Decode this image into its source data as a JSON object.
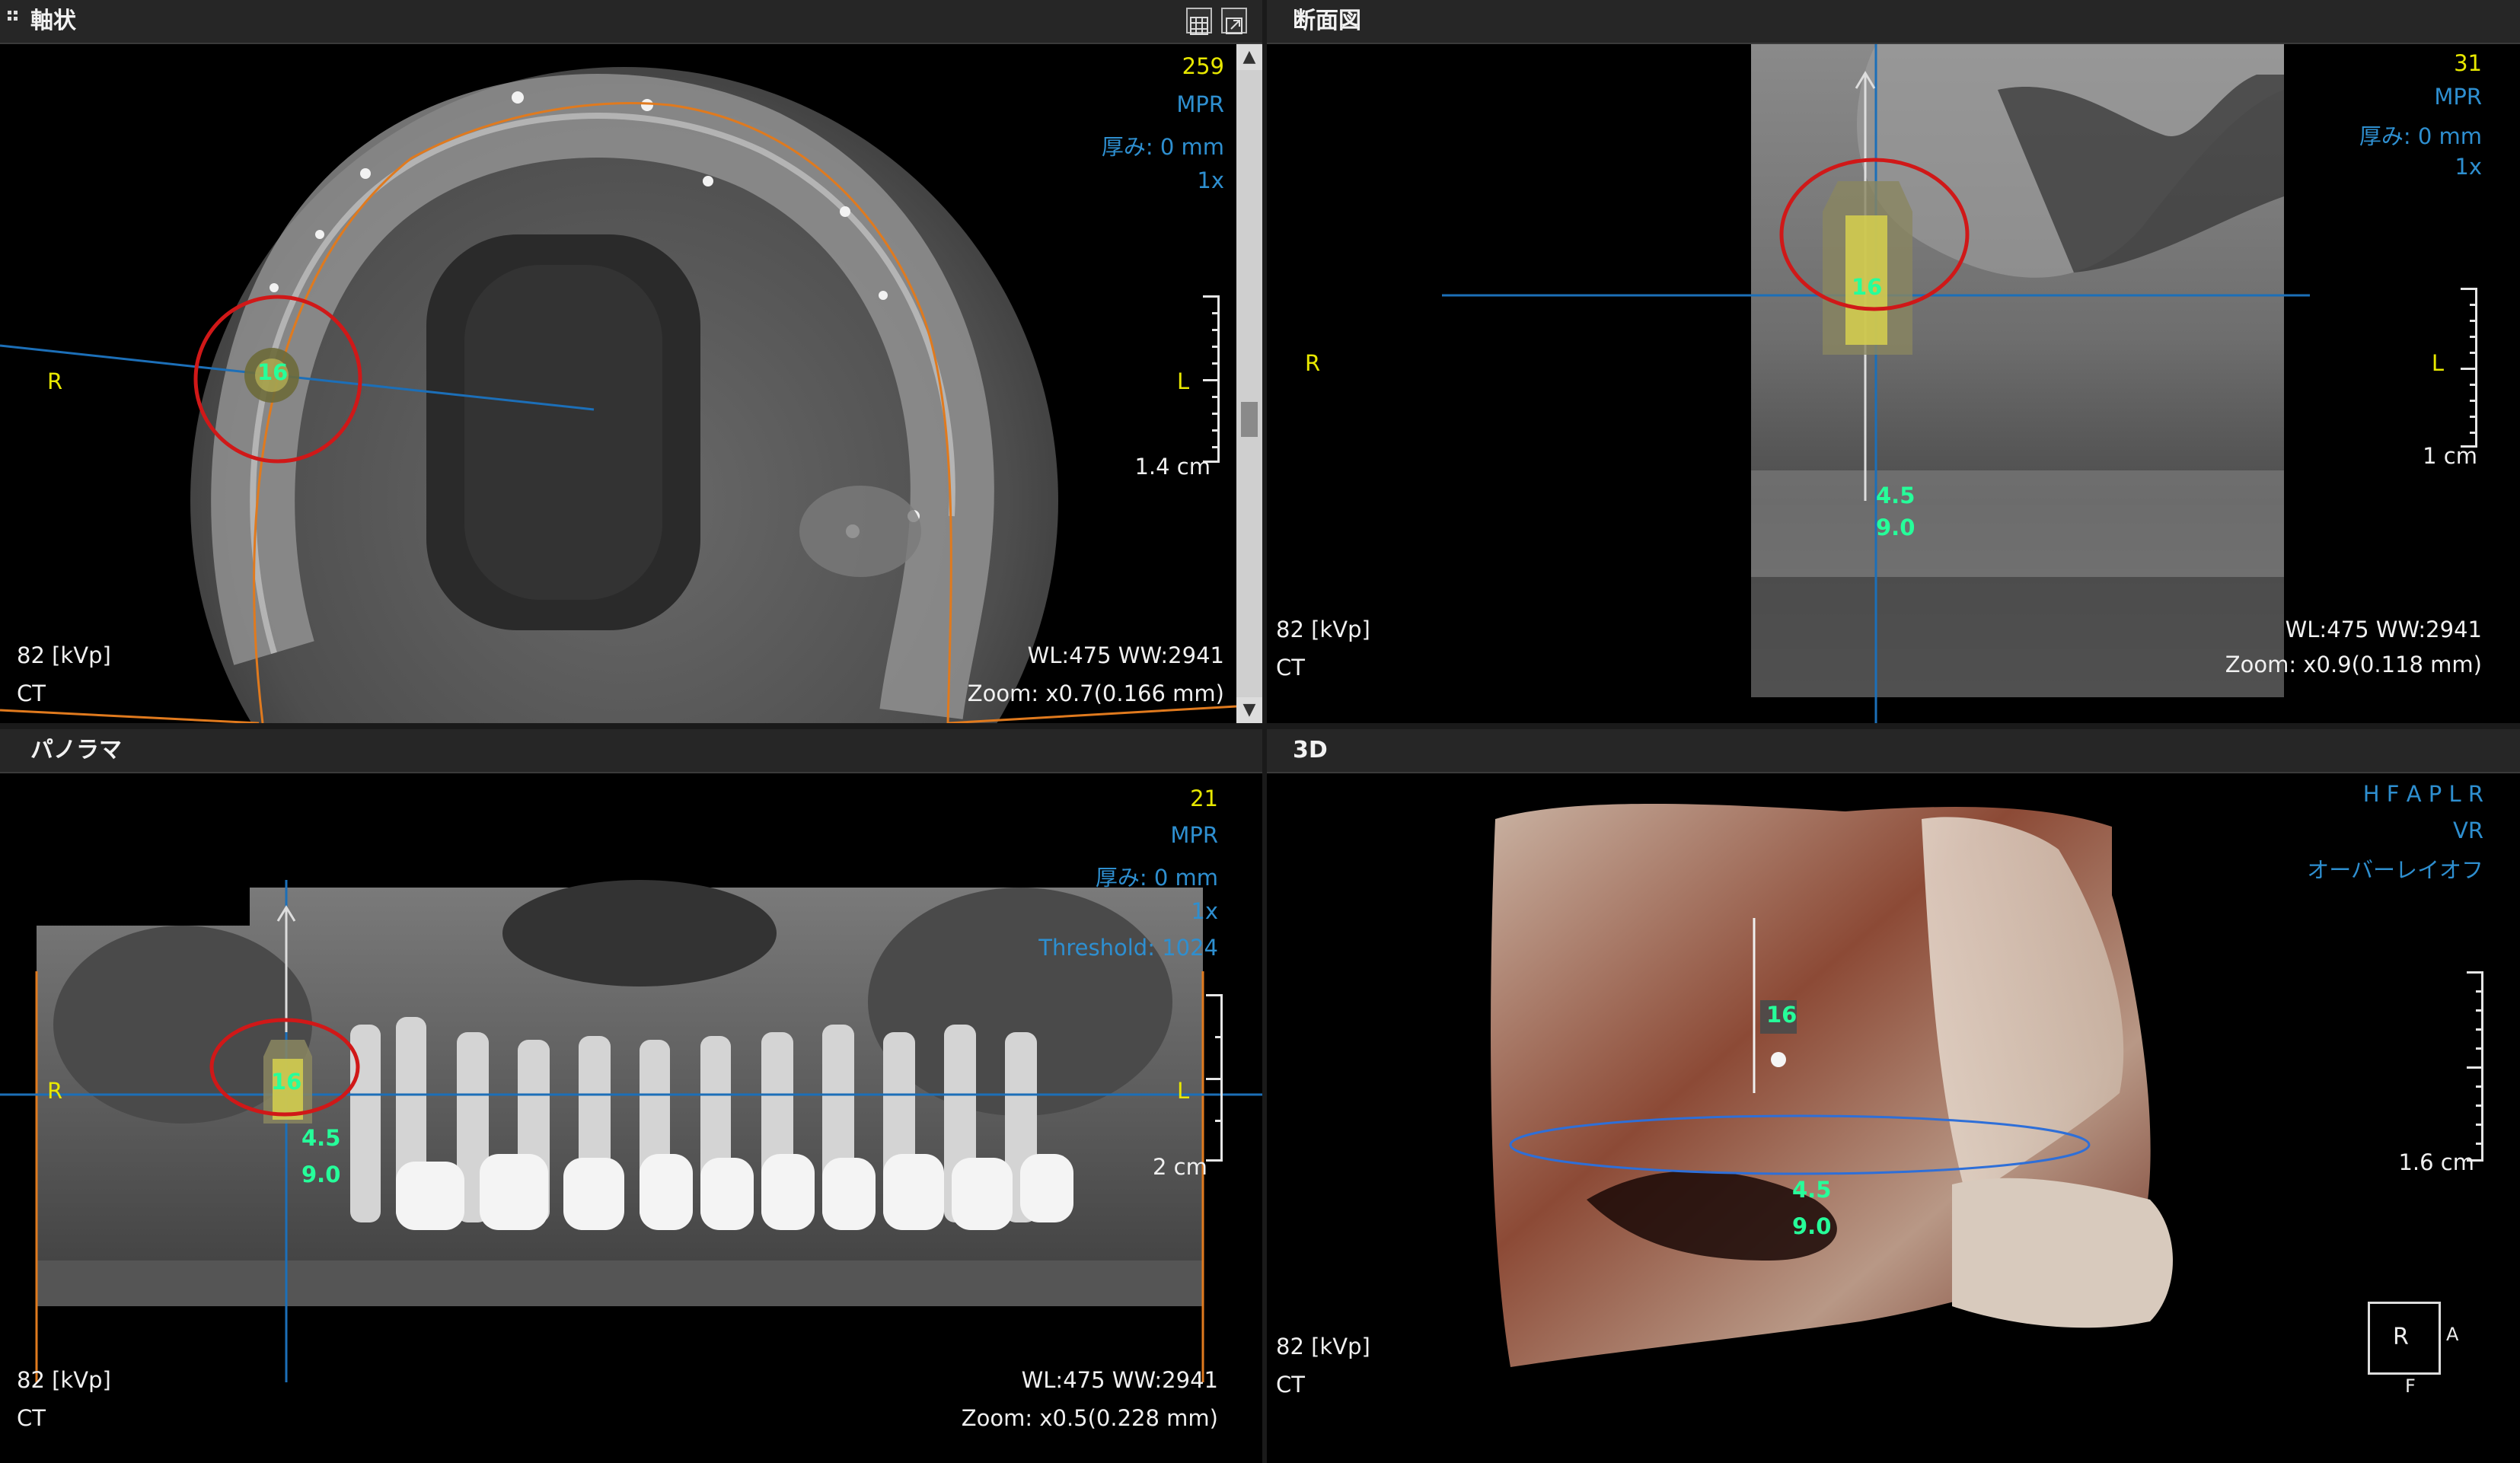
{
  "panels": {
    "axial": {
      "title": "軸状",
      "slice": "259",
      "mode": "MPR",
      "thickness": "厚み: 0 mm",
      "zoom_factor": "1x",
      "left_label": "R",
      "right_label": "L",
      "scale_label": "1.4 cm",
      "kvp": "82 [kVp]",
      "modality": "CT",
      "window": "WL:475 WW:2941",
      "zoom": "Zoom: x0.7(0.166 mm)",
      "implant_label": "16"
    },
    "cross_section": {
      "title": "断面図",
      "slice": "31",
      "mode": "MPR",
      "thickness": "厚み: 0 mm",
      "zoom_factor": "1x",
      "left_label": "R",
      "right_label": "L",
      "scale_label": "1 cm",
      "kvp": "82 [kVp]",
      "modality": "CT",
      "window": "WL:475 WW:2941",
      "zoom": "Zoom: x0.9(0.118 mm)",
      "implant_label": "16",
      "diameter": "4.5",
      "length": "9.0"
    },
    "panorama": {
      "title": "パノラマ",
      "slice": "21",
      "mode": "MPR",
      "thickness": "厚み: 0 mm",
      "zoom_factor": "1x",
      "threshold": "Threshold: 1024",
      "left_label": "R",
      "right_label": "L",
      "scale_label": "2 cm",
      "kvp": "82 [kVp]",
      "modality": "CT",
      "window": "WL:475 WW:2941",
      "zoom": "Zoom: x0.5(0.228 mm)",
      "implant_label": "16",
      "diameter": "4.5",
      "length": "9.0"
    },
    "volume3d": {
      "title": "3D",
      "orientation": "H F A P L R",
      "mode": "VR",
      "overlay": "オーバーレイオフ",
      "scale_label": "1.6 cm",
      "kvp": "82 [kVp]",
      "modality": "CT",
      "implant_label": "16",
      "diameter": "4.5",
      "length": "9.0",
      "cube_front": "R",
      "cube_side": "A",
      "cube_bottom": "F"
    }
  },
  "icons": [
    "grid-layout-icon",
    "maximize-icon",
    "grip-icon",
    "scroll-up-icon",
    "scroll-down-icon"
  ],
  "colors": {
    "yellow_text": "#e8e800",
    "blue_text": "#2e8fd0",
    "implant_text": "#26ff9a",
    "marker_circle": "#d01818",
    "arch_curve": "#e07a1e"
  }
}
